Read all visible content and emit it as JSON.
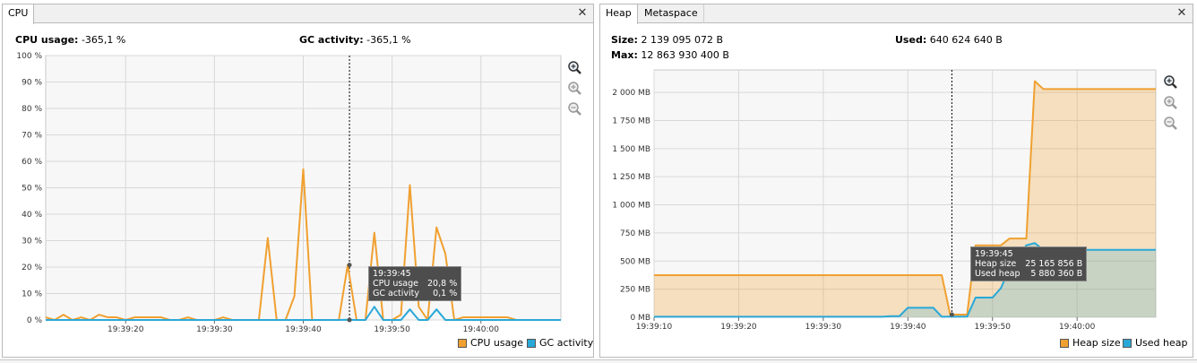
{
  "cpu": {
    "tab_label": "CPU",
    "usage_label": "CPU usage:",
    "usage_value": "-365,1 %",
    "gc_label": "GC activity:",
    "gc_value": "-365,1 %",
    "legend": {
      "cpu": "CPU usage",
      "gc": "GC activity"
    },
    "tooltip": {
      "time": "19:39:45",
      "cpu_label": "CPU usage",
      "cpu_value": "20,8 %",
      "gc_label": "GC activity",
      "gc_value": "0,1 %"
    }
  },
  "memory": {
    "tabs": [
      "Heap",
      "Metaspace"
    ],
    "size_label": "Size:",
    "size_value": "2 139 095 072 B",
    "used_label": "Used:",
    "used_value": "640 624 640 B",
    "max_label": "Max:",
    "max_value": "12 863 930 400 B",
    "legend": {
      "heap": "Heap size",
      "used": "Used heap"
    },
    "tooltip": {
      "time": "19:39:45",
      "heap_label": "Heap size",
      "heap_value": "25 165 856 B",
      "used_label": "Used heap",
      "used_value": "5 880 360 B"
    }
  },
  "colors": {
    "orange": "#f0a030",
    "blue": "#29a8d8",
    "grid": "#d8d8d8"
  },
  "icons": [
    "close-icon",
    "zoom-in-icon",
    "zoom-out-icon",
    "zoom-reset-icon"
  ],
  "chart_data": [
    {
      "type": "line",
      "ylim": [
        0,
        100
      ],
      "y_ticks": [
        "100 %",
        "90 %",
        "80 %",
        "70 %",
        "60 %",
        "50 %",
        "40 %",
        "30 %",
        "20 %",
        "10 %",
        "0 %"
      ],
      "x_ticks": [
        "19:39:20",
        "19:39:30",
        "19:39:40",
        "19:39:50",
        "19:40:00"
      ],
      "x_tick_seconds": [
        20,
        30,
        40,
        50,
        60
      ],
      "xlim_seconds": [
        11,
        69
      ],
      "cursor_seconds": 45.2,
      "series": [
        {
          "name": "CPU usage",
          "color": "#f0a030",
          "points": [
            [
              11,
              1
            ],
            [
              12,
              0
            ],
            [
              13,
              2
            ],
            [
              14,
              0
            ],
            [
              15,
              1
            ],
            [
              16,
              0
            ],
            [
              17,
              2
            ],
            [
              18,
              1
            ],
            [
              19,
              1
            ],
            [
              20,
              0
            ],
            [
              21,
              1
            ],
            [
              22,
              1
            ],
            [
              23,
              1
            ],
            [
              24,
              1
            ],
            [
              25,
              0
            ],
            [
              26,
              0
            ],
            [
              27,
              1
            ],
            [
              28,
              0
            ],
            [
              29,
              0
            ],
            [
              30,
              0
            ],
            [
              31,
              1
            ],
            [
              32,
              0
            ],
            [
              33,
              0
            ],
            [
              34,
              0
            ],
            [
              35,
              0
            ],
            [
              36,
              31
            ],
            [
              37,
              0
            ],
            [
              38,
              0
            ],
            [
              39,
              9
            ],
            [
              40,
              57
            ],
            [
              41,
              0
            ],
            [
              42,
              0
            ],
            [
              43,
              0
            ],
            [
              44,
              0
            ],
            [
              45,
              20.8
            ],
            [
              46,
              0
            ],
            [
              47,
              0
            ],
            [
              48,
              33
            ],
            [
              49,
              0
            ],
            [
              50,
              0
            ],
            [
              51,
              2
            ],
            [
              52,
              51
            ],
            [
              53,
              5
            ],
            [
              54,
              0
            ],
            [
              55,
              35
            ],
            [
              56,
              25
            ],
            [
              57,
              0
            ],
            [
              58,
              1
            ],
            [
              59,
              1
            ],
            [
              60,
              1
            ],
            [
              61,
              1
            ],
            [
              62,
              1
            ],
            [
              63,
              1
            ],
            [
              64,
              0
            ],
            [
              65,
              0
            ],
            [
              66,
              0
            ],
            [
              67,
              0
            ],
            [
              68,
              0
            ],
            [
              69,
              0
            ]
          ]
        },
        {
          "name": "GC activity",
          "color": "#29a8d8",
          "points": [
            [
              11,
              0
            ],
            [
              44,
              0
            ],
            [
              45,
              0.1
            ],
            [
              46,
              0
            ],
            [
              47,
              0
            ],
            [
              48,
              5
            ],
            [
              49,
              0
            ],
            [
              50,
              0
            ],
            [
              51,
              0
            ],
            [
              52,
              4
            ],
            [
              53,
              0
            ],
            [
              54,
              0
            ],
            [
              55,
              4
            ],
            [
              56,
              0
            ],
            [
              57,
              0
            ],
            [
              69,
              0
            ]
          ]
        }
      ]
    },
    {
      "type": "area",
      "ylim": [
        0,
        2200
      ],
      "y_ticks": [
        "2 000 MB",
        "1 750 MB",
        "1 500 MB",
        "1 250 MB",
        "1 000 MB",
        "750 MB",
        "500 MB",
        "250 MB",
        "0 MB"
      ],
      "y_tick_values": [
        2000,
        1750,
        1500,
        1250,
        1000,
        750,
        500,
        250,
        0
      ],
      "x_ticks": [
        "19:39:10",
        "19:39:20",
        "19:39:30",
        "19:39:40",
        "19:39:50",
        "19:40:00"
      ],
      "x_tick_seconds": [
        10,
        20,
        30,
        40,
        50,
        60
      ],
      "xlim_seconds": [
        10,
        69.3
      ],
      "cursor_seconds": 45.2,
      "series": [
        {
          "name": "Heap size",
          "color": "#f0a030",
          "points": [
            [
              10,
              375
            ],
            [
              44,
              375
            ],
            [
              45,
              24
            ],
            [
              46,
              24
            ],
            [
              47,
              24
            ],
            [
              48,
              640
            ],
            [
              49,
              640
            ],
            [
              50,
              640
            ],
            [
              51,
              640
            ],
            [
              52,
              700
            ],
            [
              53,
              700
            ],
            [
              54,
              700
            ],
            [
              55,
              2100
            ],
            [
              56,
              2030
            ],
            [
              60,
              2030
            ],
            [
              69.3,
              2030
            ]
          ]
        },
        {
          "name": "Used heap",
          "color": "#29a8d8",
          "points": [
            [
              10,
              5
            ],
            [
              37,
              5
            ],
            [
              38,
              10
            ],
            [
              39,
              10
            ],
            [
              40,
              85
            ],
            [
              41,
              85
            ],
            [
              42,
              85
            ],
            [
              43,
              85
            ],
            [
              44,
              5
            ],
            [
              45,
              6
            ],
            [
              46,
              6
            ],
            [
              47,
              6
            ],
            [
              48,
              175
            ],
            [
              49,
              175
            ],
            [
              50,
              175
            ],
            [
              51,
              260
            ],
            [
              52,
              430
            ],
            [
              53,
              525
            ],
            [
              54,
              640
            ],
            [
              55,
              660
            ],
            [
              56,
              600
            ],
            [
              57,
              600
            ],
            [
              58,
              600
            ],
            [
              60,
              600
            ],
            [
              69.3,
              600
            ]
          ]
        }
      ]
    }
  ]
}
